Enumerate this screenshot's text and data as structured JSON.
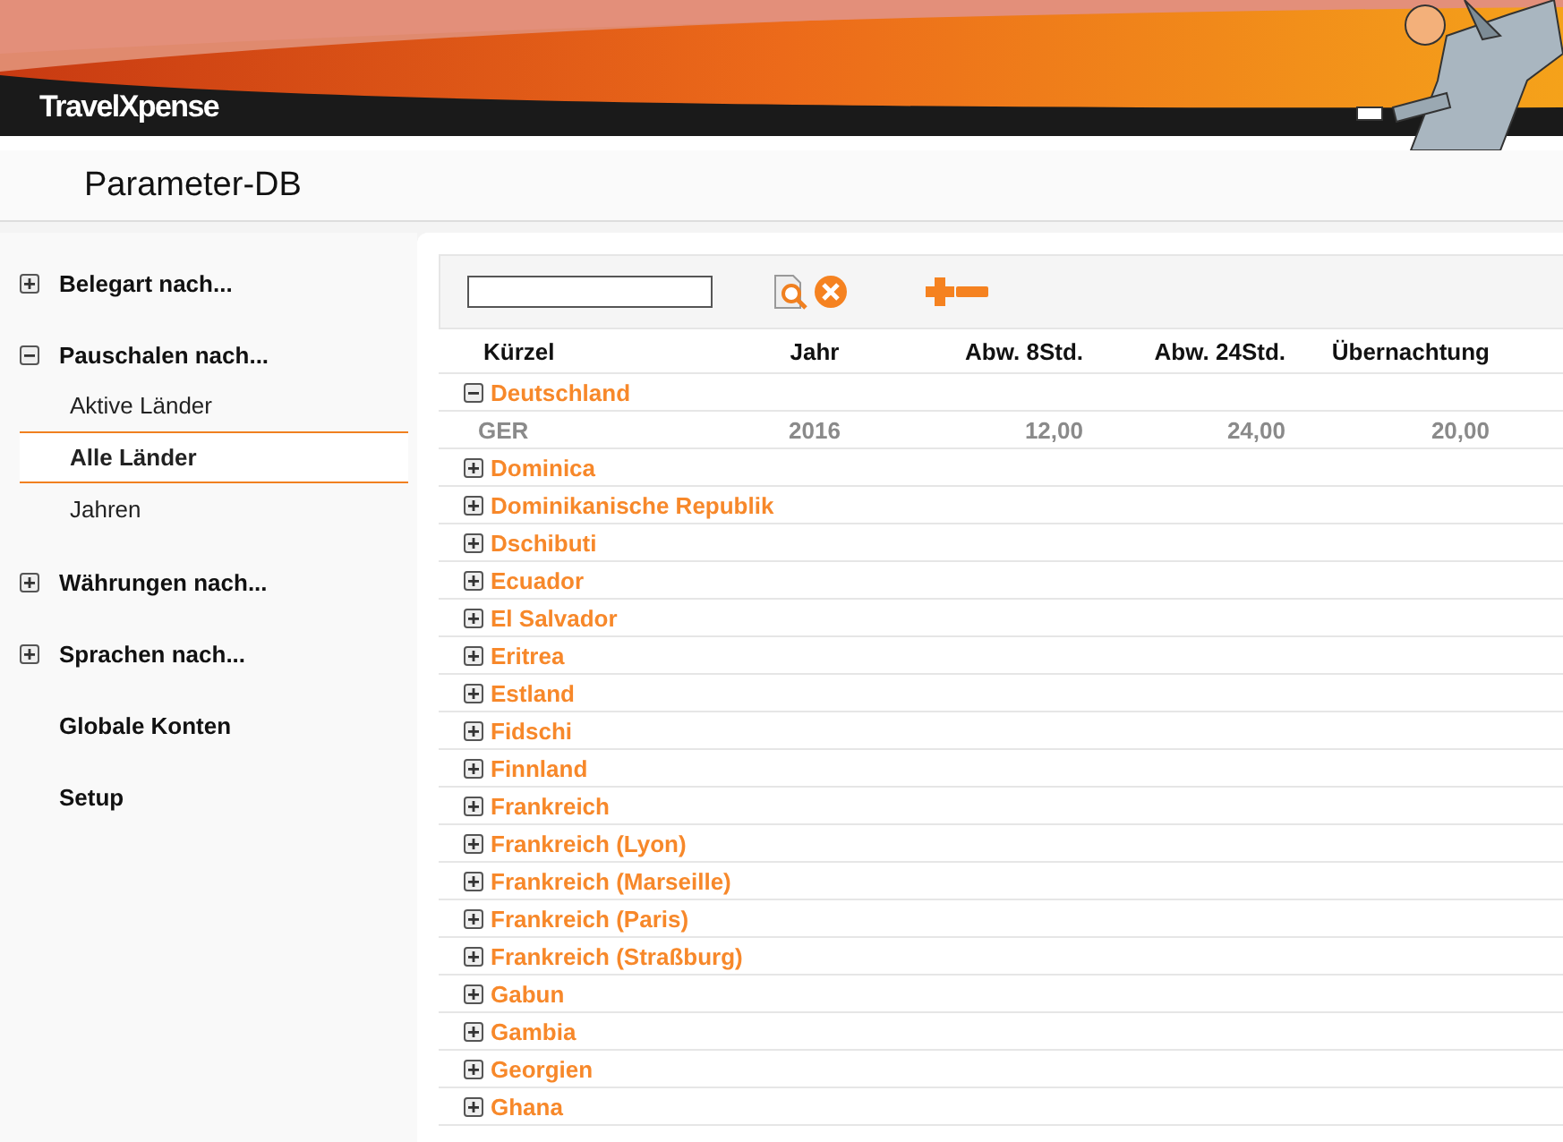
{
  "header": {
    "logo": "TravelXpense"
  },
  "page_title": "Parameter-DB",
  "sidebar": {
    "items": [
      {
        "label": "Belegart nach...",
        "expanded": false
      },
      {
        "label": "Pauschalen nach...",
        "expanded": true,
        "children": [
          {
            "label": "Aktive Länder",
            "selected": false
          },
          {
            "label": "Alle Länder",
            "selected": true
          },
          {
            "label": "Jahren",
            "selected": false
          }
        ]
      },
      {
        "label": "Währungen nach...",
        "expanded": false
      },
      {
        "label": "Sprachen nach...",
        "expanded": false
      },
      {
        "label": "Globale Konten"
      },
      {
        "label": "Setup"
      }
    ]
  },
  "table": {
    "columns": [
      "Kürzel",
      "Jahr",
      "Abw. 8Std.",
      "Abw. 24Std.",
      "Übernachtung"
    ],
    "groups": [
      {
        "name": "Deutschland",
        "expanded": true,
        "rows": [
          {
            "cells": [
              "GER",
              "2016",
              "12,00",
              "24,00",
              "20,00"
            ]
          }
        ]
      },
      {
        "name": "Dominica",
        "expanded": false
      },
      {
        "name": "Dominikanische Republik",
        "expanded": false
      },
      {
        "name": "Dschibuti",
        "expanded": false
      },
      {
        "name": "Ecuador",
        "expanded": false
      },
      {
        "name": "El Salvador",
        "expanded": false
      },
      {
        "name": "Eritrea",
        "expanded": false
      },
      {
        "name": "Estland",
        "expanded": false
      },
      {
        "name": "Fidschi",
        "expanded": false
      },
      {
        "name": "Finnland",
        "expanded": false
      },
      {
        "name": "Frankreich",
        "expanded": false
      },
      {
        "name": "Frankreich (Lyon)",
        "expanded": false
      },
      {
        "name": "Frankreich (Marseille)",
        "expanded": false
      },
      {
        "name": "Frankreich (Paris)",
        "expanded": false
      },
      {
        "name": "Frankreich (Straßburg)",
        "expanded": false
      },
      {
        "name": "Gabun",
        "expanded": false
      },
      {
        "name": "Gambia",
        "expanded": false
      },
      {
        "name": "Georgien",
        "expanded": false
      },
      {
        "name": "Ghana",
        "expanded": false
      }
    ]
  }
}
